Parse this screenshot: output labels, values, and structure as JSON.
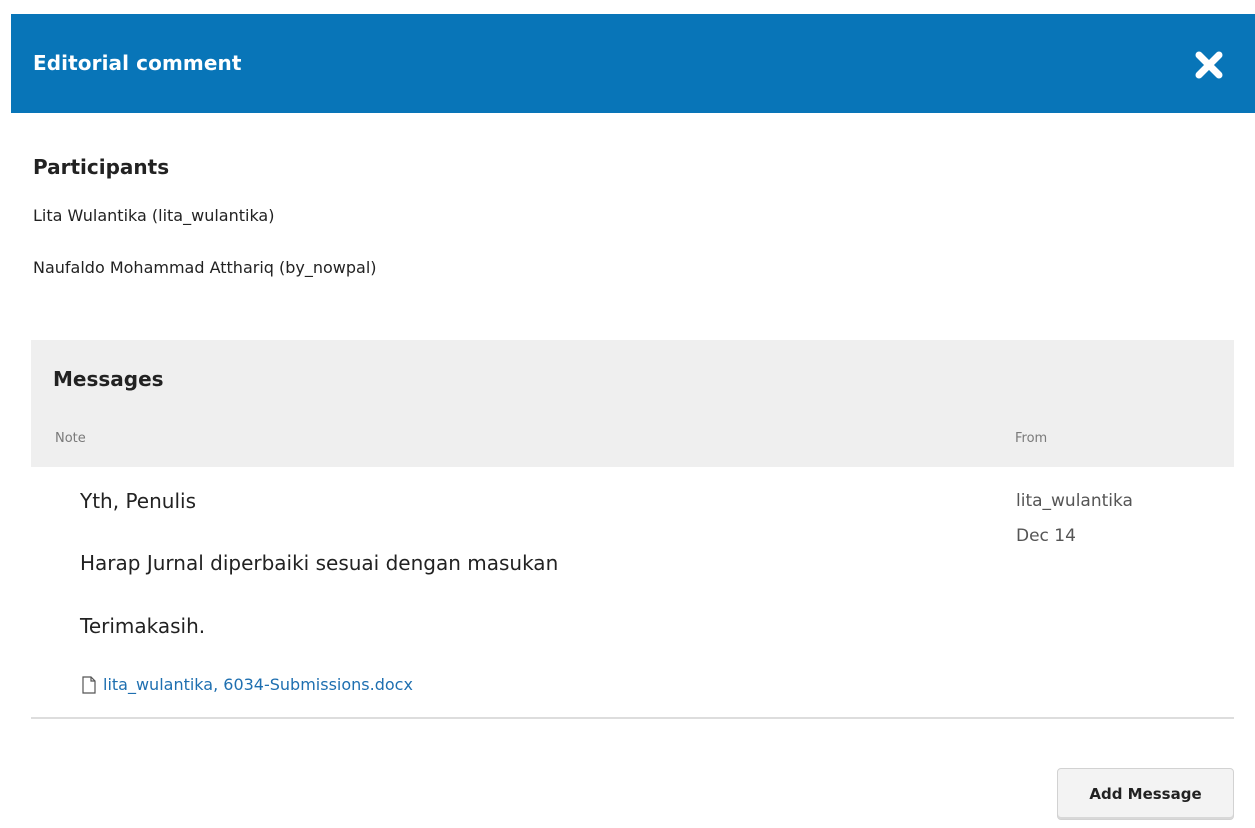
{
  "modal": {
    "title": "Editorial comment",
    "close_icon": "close-x-icon",
    "header_color": "#0875b8"
  },
  "participants": {
    "heading": "Participants",
    "items": [
      "Lita Wulantika (lita_wulantika)",
      "Naufaldo Mohammad Atthariq (by_nowpal)"
    ]
  },
  "messages": {
    "title": "Messages",
    "columns": {
      "note": "Note",
      "from": "From"
    },
    "items": [
      {
        "lines": [
          "Yth, Penulis",
          "Harap Jurnal diperbaiki sesuai dengan masukan",
          "Terimakasih."
        ],
        "attachment": {
          "icon": "file-icon",
          "label": "lita_wulantika, 6034-Submissions.docx"
        },
        "from_user": "lita_wulantika",
        "date": "Dec 14"
      }
    ]
  },
  "actions": {
    "add_message_label": "Add Message"
  }
}
